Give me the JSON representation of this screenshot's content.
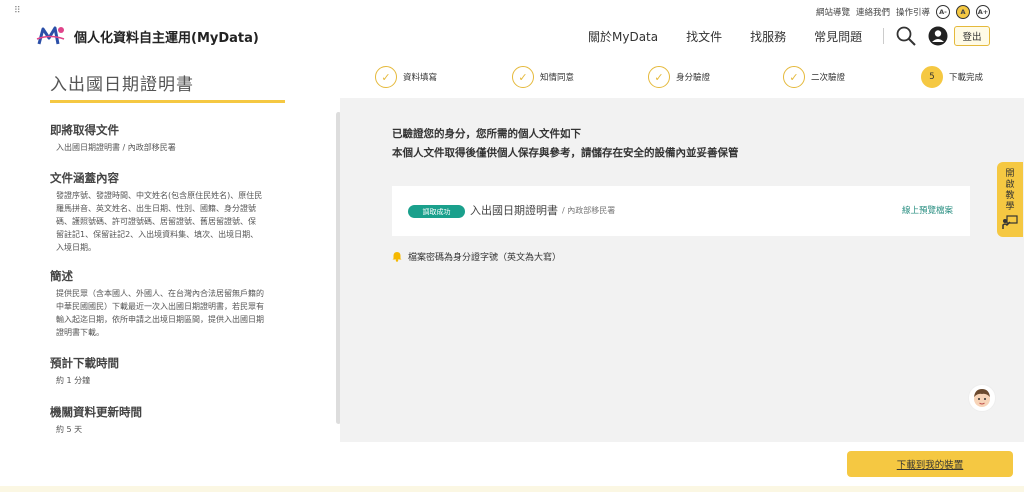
{
  "header": {
    "site_name": "個人化資料自主運用(MyData)",
    "util_links": [
      "網站導覽",
      "連絡我們",
      "操作引導"
    ],
    "font_sizes": [
      "A-",
      "A",
      "A+"
    ],
    "nav": [
      "關於MyData",
      "找文件",
      "找服務",
      "常見問題"
    ],
    "logout_label": "登出",
    "brand_color": "#f5c842"
  },
  "left": {
    "doc_title": "入出國日期證明書",
    "sections": [
      {
        "heading": "即將取得文件",
        "lines": [
          "入出國日期證明書 / 內政部移民署"
        ]
      },
      {
        "heading": "文件涵蓋內容",
        "lines": [
          "發證序號、發證時間、中文姓名(包含原住民姓名)、原住民",
          "羅馬拼音、英文姓名、出生日期、性別、國籍、身分證號",
          "碼、護照號碼、許可證號碼、居留證號、舊居留證號、保",
          "留註記1、保留註記2、入出境資料集、填次、出境日期、",
          "入境日期。"
        ]
      },
      {
        "heading": "簡述",
        "lines": [
          "提供民眾（含本國人、外國人、在台灣內合法居留無戶籍的",
          "中華民國國民）下載最近一次入出國日期證明書，若民眾有",
          "輸入起迄日期，依所申請之出境日期區間，提供入出國日期",
          "證明書下載。"
        ]
      },
      {
        "heading": "預計下載時間",
        "lines": [
          "約 1 分鐘"
        ]
      },
      {
        "heading": "機關資料更新時間",
        "lines": [
          "約 5 天"
        ]
      }
    ]
  },
  "steps": [
    {
      "label": "資料填寫",
      "mark": "✓"
    },
    {
      "label": "知情同意",
      "mark": "✓"
    },
    {
      "label": "身分驗證",
      "mark": "✓"
    },
    {
      "label": "二次驗證",
      "mark": "✓"
    },
    {
      "label": "下載完成",
      "mark": "5"
    }
  ],
  "main": {
    "msg1": "已驗證您的身分，您所需的個人文件如下",
    "msg2": "本個人文件取得後僅供個人保存與參考，請儲存在安全的設備內並妥善保管",
    "card": {
      "badge": "調取成功",
      "title": "入出國日期證明書",
      "org": "/ 內政部移民署",
      "preview": "線上預覽檔案"
    },
    "note": "檔案密碼為身分證字號（英文為大寫）"
  },
  "side_tab": "開啟教學",
  "download_label": "下載到我的裝置"
}
